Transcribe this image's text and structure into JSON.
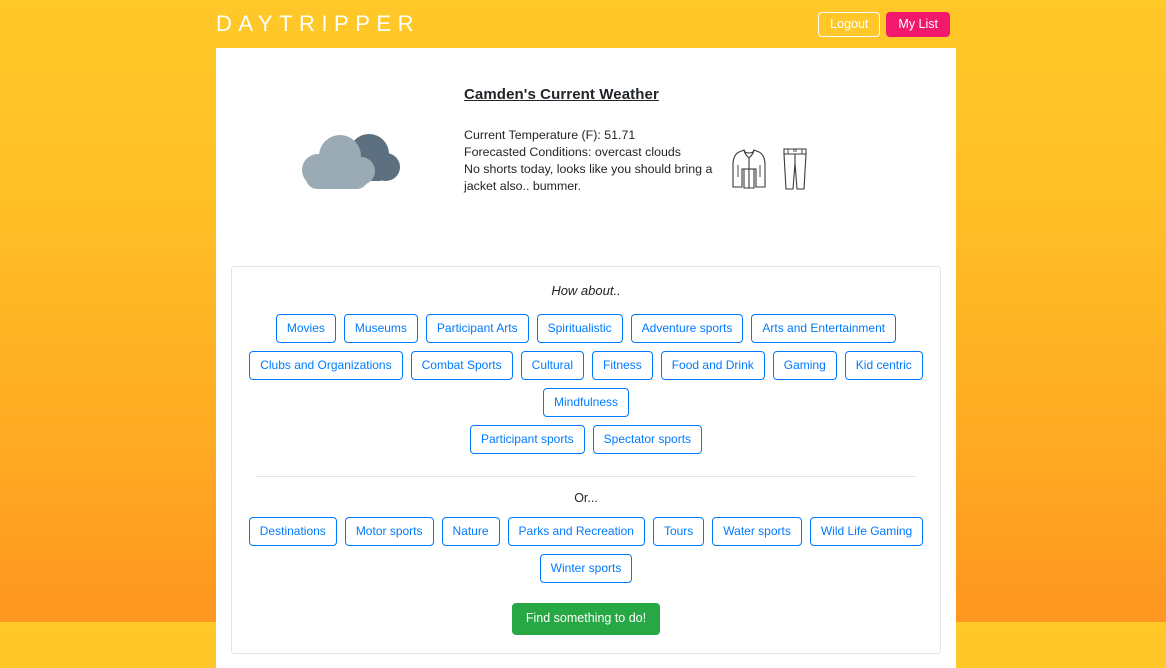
{
  "brand": "DAYTRIPPER",
  "nav": {
    "logout_label": "Logout",
    "mylist_label": "My List"
  },
  "weather": {
    "title": "Camden's Current Weather",
    "temperature_line": "Current Temperature (F): 51.71",
    "conditions_line": "Forecasted Conditions: overcast clouds",
    "advice_line": "No shorts today, looks like you should bring a jacket also.. bummer.",
    "icon": "overcast-clouds-icon",
    "clothing_icons": [
      "jacket-icon",
      "pants-icon"
    ]
  },
  "activities": {
    "how_about_label": "How about..",
    "or_label": "Or...",
    "primary_rows": [
      [
        "Movies",
        "Museums",
        "Participant Arts",
        "Spiritualistic",
        "Adventure sports",
        "Arts and Entertainment"
      ],
      [
        "Clubs and Organizations",
        "Combat Sports",
        "Cultural",
        "Fitness",
        "Food and Drink",
        "Gaming",
        "Kid centric",
        "Mindfulness"
      ],
      [
        "Participant sports",
        "Spectator sports"
      ]
    ],
    "secondary_rows": [
      [
        "Destinations",
        "Motor sports",
        "Nature",
        "Parks and Recreation",
        "Tours",
        "Water sports",
        "Wild Life Gaming",
        "Winter sports"
      ]
    ],
    "cta_label": "Find something to do!"
  },
  "colors": {
    "background_top": "#ffc928",
    "background_bottom": "#ff9620",
    "accent_pink": "#f2186b",
    "accent_blue": "#007bff",
    "accent_green": "#28a745",
    "cloud_front": "#9aabb5",
    "cloud_back": "#5c7080"
  }
}
